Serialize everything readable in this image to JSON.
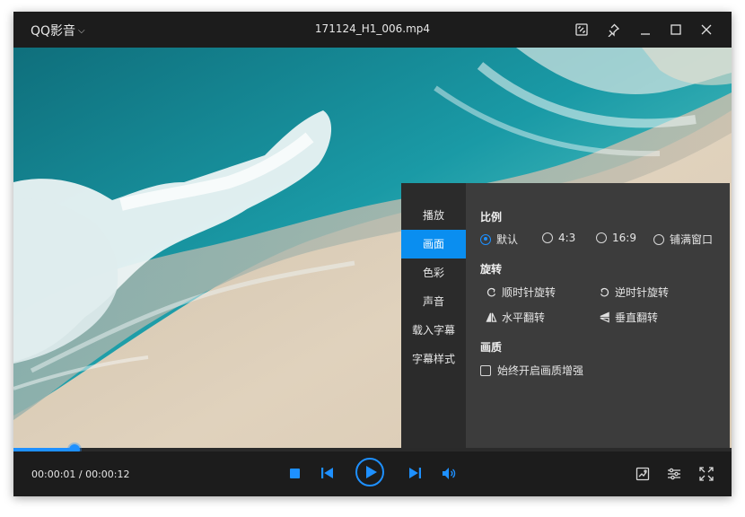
{
  "app": {
    "name": "QQ影音",
    "file_name": "171124_H1_006.mp4"
  },
  "titlebar": {
    "icons": [
      "screenshot-icon",
      "pin-icon",
      "minimize-icon",
      "maximize-icon",
      "close-icon"
    ]
  },
  "settings_panel": {
    "nav": [
      {
        "label": "播放",
        "active": false
      },
      {
        "label": "画面",
        "active": true
      },
      {
        "label": "色彩",
        "active": false
      },
      {
        "label": "声音",
        "active": false
      },
      {
        "label": "载入字幕",
        "active": false
      },
      {
        "label": "字幕样式",
        "active": false
      }
    ],
    "ratio": {
      "title": "比例",
      "options": [
        {
          "label": "默认",
          "selected": true
        },
        {
          "label": "4:3",
          "selected": false
        },
        {
          "label": "16:9",
          "selected": false
        },
        {
          "label": "铺满窗口",
          "selected": false
        }
      ]
    },
    "rotate": {
      "title": "旋转",
      "options": [
        {
          "label": "顺时针旋转",
          "icon": "rotate-clockwise-icon"
        },
        {
          "label": "逆时针旋转",
          "icon": "rotate-counterclockwise-icon"
        },
        {
          "label": "水平翻转",
          "icon": "flip-horizontal-icon"
        },
        {
          "label": "垂直翻转",
          "icon": "flip-vertical-icon"
        }
      ]
    },
    "quality": {
      "title": "画质",
      "checkbox_label": "始终开启画质增强",
      "checked": false
    }
  },
  "playback": {
    "current_time": "00:00:01",
    "total_time": "00:00:12",
    "time_display": "00:00:01 / 00:00:12",
    "progress_fraction": 0.085
  },
  "colors": {
    "accent": "#1e90ff",
    "panel_bg": "#3c3c3c",
    "nav_bg": "#2b2b2b",
    "active_nav": "#0a8ef0",
    "window_bg": "#1c1c1c"
  }
}
